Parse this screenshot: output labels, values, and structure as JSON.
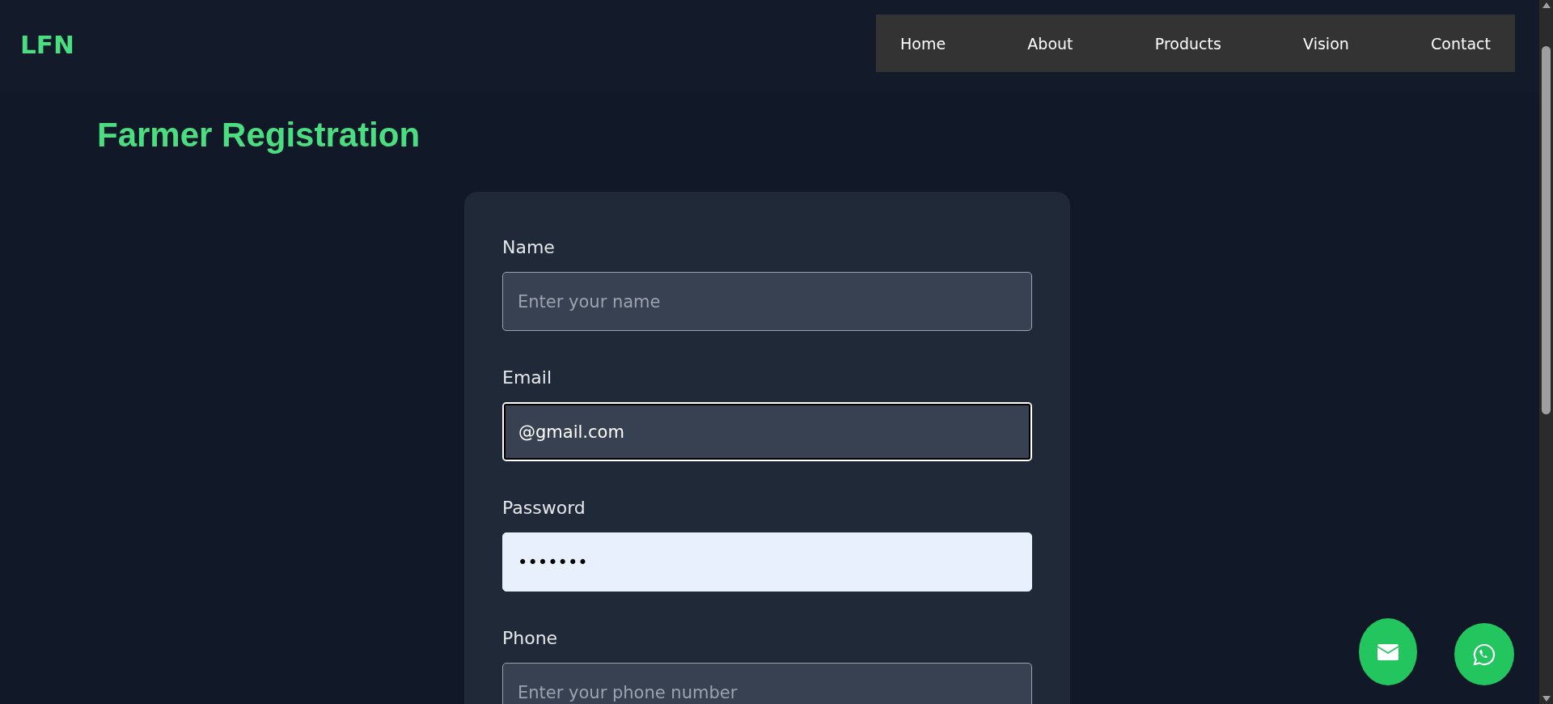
{
  "logo": "LFN",
  "nav": [
    {
      "label": "Home"
    },
    {
      "label": "About"
    },
    {
      "label": "Products"
    },
    {
      "label": "Vision"
    },
    {
      "label": "Contact"
    }
  ],
  "title": "Farmer Registration",
  "form": {
    "fields": [
      {
        "label": "Name",
        "placeholder": "Enter your name",
        "focused": false,
        "autofilled": false
      },
      {
        "label": "Email",
        "value": "@gmail.com",
        "focused": true,
        "autofilled": false
      },
      {
        "label": "Password",
        "value": "•••••••",
        "focused": false,
        "autofilled": true
      },
      {
        "label": "Phone",
        "placeholder": "Enter your phone number",
        "focused": false,
        "autofilled": false
      }
    ]
  },
  "floating_buttons": [
    {
      "kind": "email"
    },
    {
      "kind": "whatsapp"
    }
  ]
}
